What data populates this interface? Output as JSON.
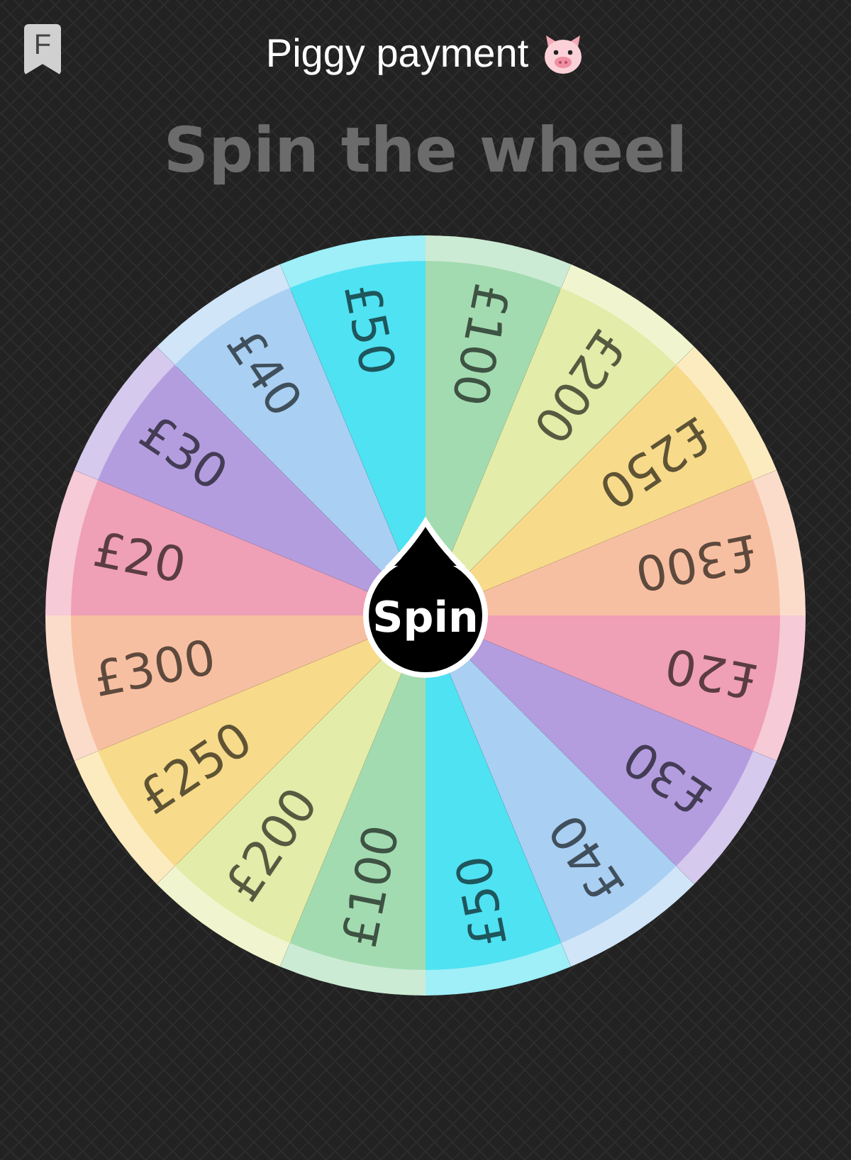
{
  "header": {
    "badge": "F",
    "title": "Piggy payment"
  },
  "heading": "Spin the wheel",
  "wheel": {
    "segments": [
      {
        "label": "£100",
        "color": "#a3dbb0"
      },
      {
        "label": "£200",
        "color": "#e3eca8"
      },
      {
        "label": "£250",
        "color": "#f7da8a"
      },
      {
        "label": "£300",
        "color": "#f7bfa1"
      },
      {
        "label": "£20",
        "color": "#ef9fb6"
      },
      {
        "label": "£30",
        "color": "#b39ddf"
      },
      {
        "label": "£40",
        "color": "#a9cff2"
      },
      {
        "label": "£50",
        "color": "#4fe2f2"
      },
      {
        "label": "£100",
        "color": "#a3dbb0"
      },
      {
        "label": "£200",
        "color": "#e3eca8"
      },
      {
        "label": "£250",
        "color": "#f7da8a"
      },
      {
        "label": "£300",
        "color": "#f7bfa1"
      },
      {
        "label": "£20",
        "color": "#ef9fb6"
      },
      {
        "label": "£30",
        "color": "#b39ddf"
      },
      {
        "label": "£40",
        "color": "#a9cff2"
      },
      {
        "label": "£50",
        "color": "#4fe2f2"
      }
    ],
    "button": "Spin"
  }
}
